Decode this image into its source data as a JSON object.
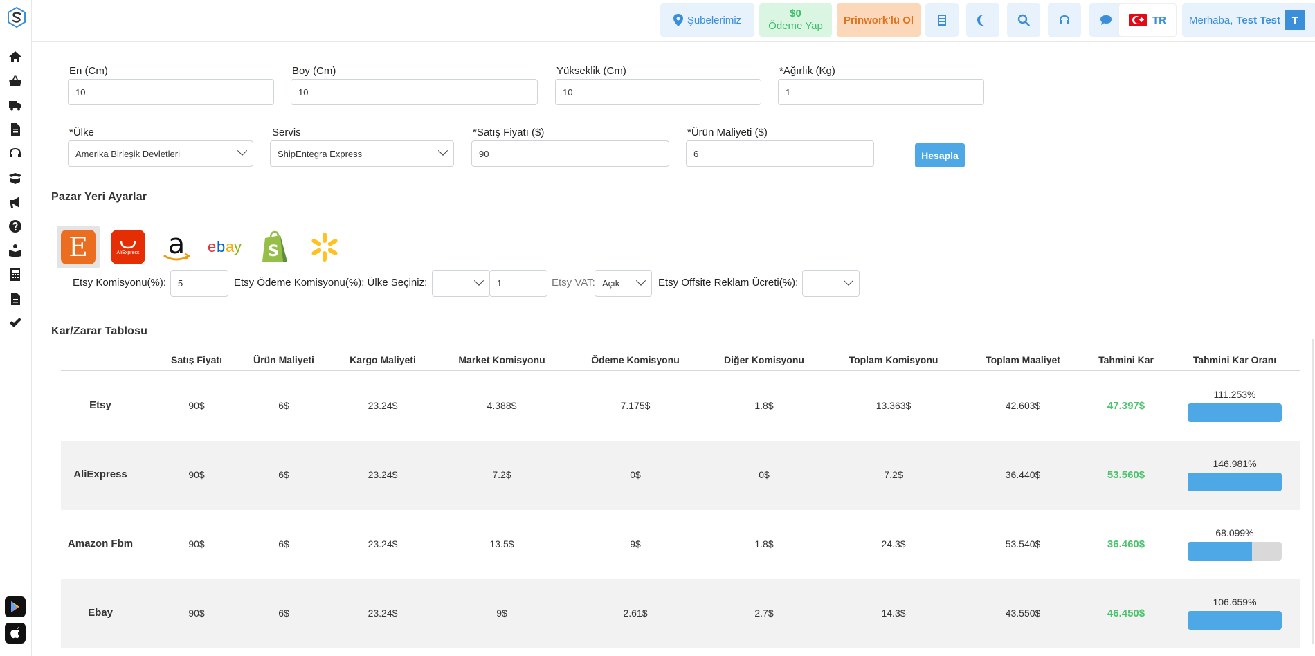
{
  "topbar": {
    "branches": "Şubelerimiz",
    "pay_amount": "$0",
    "pay_label": "Ödeme Yap",
    "prinwork": "Prinwork'lü Ol",
    "lang": "TR",
    "greeting": "Merhaba,",
    "username": "Test Test",
    "avatar_initial": "T"
  },
  "form": {
    "en_label": "En (Cm)",
    "en_value": "10",
    "boy_label": "Boy (Cm)",
    "boy_value": "10",
    "yuk_label": "Yükseklik (Cm)",
    "yuk_value": "10",
    "agirlik_label": "*Ağırlık (Kg)",
    "agirlik_value": "1",
    "ulke_label": "*Ülke",
    "ulke_value": "Amerika Birleşik Devletleri",
    "servis_label": "Servis",
    "servis_value": "ShipEntegra Express",
    "satis_label": "*Satış Fiyatı ($)",
    "satis_value": "90",
    "maliyet_label": "*Ürün Maliyeti ($)",
    "maliyet_value": "6",
    "hesapla": "Hesapla"
  },
  "marketplace": {
    "title": "Pazar Yeri Ayarlar",
    "etsy_letter": "E",
    "ali_text": "AliExpress",
    "ebay_e": "e",
    "ebay_b": "b",
    "ebay_a": "a",
    "ebay_y": "y",
    "commission_label": "Etsy Komisyonu(%):",
    "commission_value": "5",
    "payment_label": "Etsy Ödeme Komisyonu(%): Ülke Seçiniz:",
    "payment_value": "1",
    "vat_label": "Etsy VAT:",
    "vat_value": "Açık",
    "offsite_label": "Etsy Offsite Reklam Ücreti(%):"
  },
  "table": {
    "title": "Kar/Zarar Tablosu",
    "headers": [
      "Satış Fiyatı",
      "Ürün Maliyeti",
      "Kargo Maliyeti",
      "Market Komisyonu",
      "Ödeme Komisyonu",
      "Diğer Komisyonu",
      "Toplam Komisyonu",
      "Toplam Maaliyet",
      "Tahmini Kar",
      "Tahmini Kar Oranı"
    ],
    "rows": [
      {
        "name": "Etsy",
        "cells": [
          "90$",
          "6$",
          "23.24$",
          "4.388$",
          "7.175$",
          "1.8$",
          "13.363$",
          "42.603$",
          "47.397$"
        ],
        "ratio": "111.253%",
        "fill": 1.0
      },
      {
        "name": "AliExpress",
        "cells": [
          "90$",
          "6$",
          "23.24$",
          "7.2$",
          "0$",
          "0$",
          "7.2$",
          "36.440$",
          "53.560$"
        ],
        "ratio": "146.981%",
        "fill": 1.0
      },
      {
        "name": "Amazon Fbm",
        "cells": [
          "90$",
          "6$",
          "23.24$",
          "13.5$",
          "9$",
          "1.8$",
          "24.3$",
          "53.540$",
          "36.460$"
        ],
        "ratio": "68.099%",
        "fill": 0.681
      },
      {
        "name": "Ebay",
        "cells": [
          "90$",
          "6$",
          "23.24$",
          "9$",
          "2.61$",
          "2.7$",
          "14.3$",
          "43.550$",
          "46.450$"
        ],
        "ratio": "106.659%",
        "fill": 1.0
      }
    ]
  }
}
